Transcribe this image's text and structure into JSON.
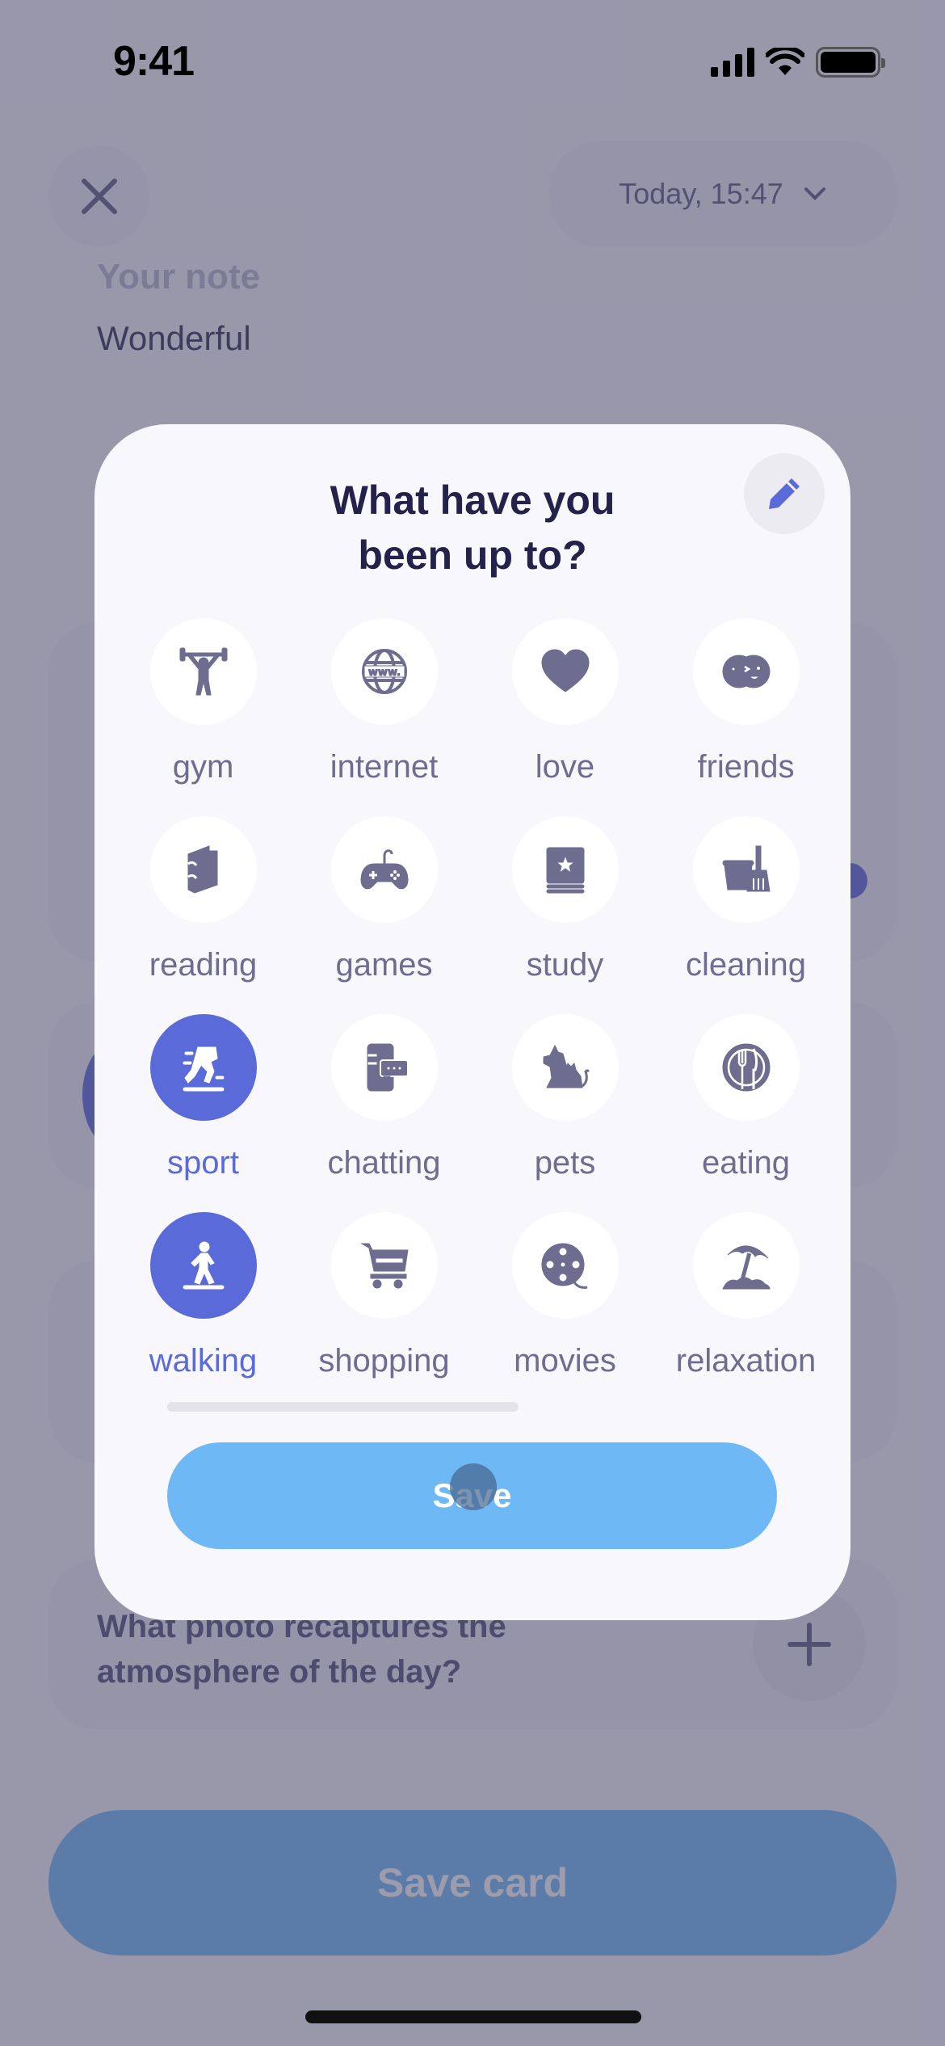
{
  "status_bar": {
    "time": "9:41"
  },
  "header": {
    "close_icon": "close-icon",
    "date_label": "Today, 15:47",
    "date_chevron_icon": "chevron-down-icon"
  },
  "note": {
    "label": "Your note",
    "value": "Wonderful"
  },
  "photo_section": {
    "question": "What photo recaptures the atmosphere of the day?",
    "add_icon": "plus-icon"
  },
  "save_card_label": "Save card",
  "modal": {
    "title_line1": "What have you",
    "title_line2": "been up to?",
    "edit_icon": "pencil-icon",
    "activities": [
      {
        "label": "gym",
        "icon": "weightlifter-icon",
        "selected": false
      },
      {
        "label": "internet",
        "icon": "globe-www-icon",
        "selected": false
      },
      {
        "label": "love",
        "icon": "heart-icon",
        "selected": false
      },
      {
        "label": "friends",
        "icon": "friends-faces-icon",
        "selected": false
      },
      {
        "label": "reading",
        "icon": "book-icon",
        "selected": false
      },
      {
        "label": "games",
        "icon": "gamepad-icon",
        "selected": false
      },
      {
        "label": "study",
        "icon": "star-book-icon",
        "selected": false
      },
      {
        "label": "cleaning",
        "icon": "bucket-broom-icon",
        "selected": false
      },
      {
        "label": "sport",
        "icon": "running-icon",
        "selected": true
      },
      {
        "label": "chatting",
        "icon": "phone-chat-icon",
        "selected": false
      },
      {
        "label": "pets",
        "icon": "dog-cat-icon",
        "selected": false
      },
      {
        "label": "eating",
        "icon": "plate-cutlery-icon",
        "selected": false
      },
      {
        "label": "walking",
        "icon": "walking-person-icon",
        "selected": true
      },
      {
        "label": "shopping",
        "icon": "cart-icon",
        "selected": false
      },
      {
        "label": "movies",
        "icon": "film-reel-icon",
        "selected": false
      },
      {
        "label": "relaxation",
        "icon": "beach-umbrella-icon",
        "selected": false
      }
    ],
    "save_label": "Save"
  },
  "colors": {
    "accent": "#5a6ad8",
    "save_button": "#6fb8f6",
    "icon_default": "#6e6c8f",
    "title": "#24214a"
  }
}
